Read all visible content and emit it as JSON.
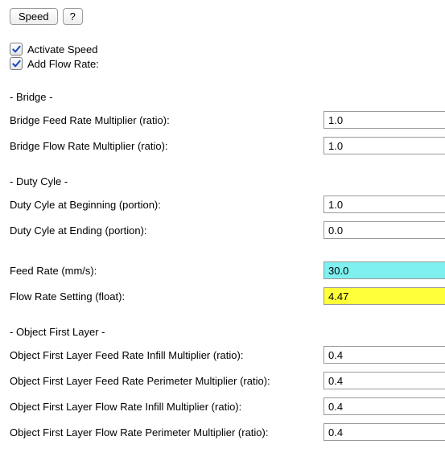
{
  "top": {
    "speed_btn": "Speed",
    "help_btn": "?"
  },
  "checks": {
    "activate_speed": {
      "label": "Activate Speed",
      "checked": true
    },
    "add_flow_rate": {
      "label": "Add Flow Rate:",
      "checked": true
    }
  },
  "sections": {
    "bridge": {
      "header": "- Bridge -",
      "feed_mult": {
        "label": "Bridge Feed Rate Multiplier (ratio):",
        "value": "1.0"
      },
      "flow_mult": {
        "label": "Bridge Flow Rate Multiplier (ratio):",
        "value": "1.0"
      }
    },
    "duty": {
      "header": "- Duty Cyle -",
      "begin": {
        "label": "Duty Cyle at Beginning (portion):",
        "value": "1.0"
      },
      "end": {
        "label": "Duty Cyle at Ending (portion):",
        "value": "0.0"
      }
    },
    "rates": {
      "feed": {
        "label": "Feed Rate (mm/s):",
        "value": "30.0",
        "highlight": "cyan"
      },
      "flow": {
        "label": "Flow Rate Setting (float):",
        "value": "4.47",
        "highlight": "yellow"
      }
    },
    "first_layer": {
      "header": "- Object First Layer -",
      "feed_infill": {
        "label": "Object First Layer Feed Rate Infill Multiplier (ratio):",
        "value": "0.4"
      },
      "feed_perimeter": {
        "label": "Object First Layer Feed Rate Perimeter Multiplier (ratio):",
        "value": "0.4"
      },
      "flow_infill": {
        "label": "Object First Layer Flow Rate Infill Multiplier (ratio):",
        "value": "0.4"
      },
      "flow_perimeter": {
        "label": "Object First Layer Flow Rate Perimeter Multiplier (ratio):",
        "value": "0.4"
      }
    }
  }
}
